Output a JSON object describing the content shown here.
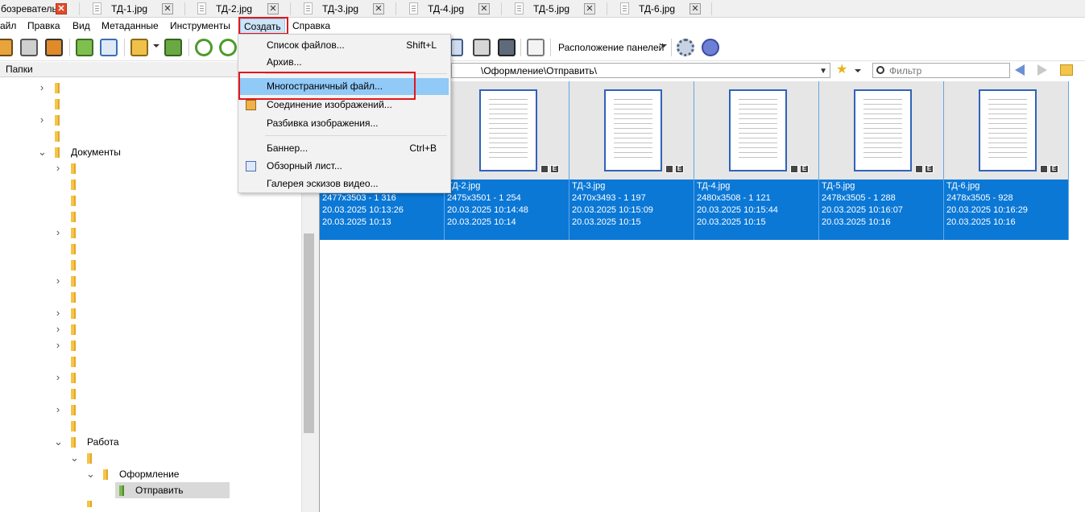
{
  "tabs": [
    {
      "label": "бозреватель",
      "close": "✕",
      "active": true
    },
    {
      "label": "ТД-1.jpg",
      "close": "✕"
    },
    {
      "label": "ТД-2.jpg",
      "close": "✕"
    },
    {
      "label": "ТД-3.jpg",
      "close": "✕"
    },
    {
      "label": "ТД-4.jpg",
      "close": "✕"
    },
    {
      "label": "ТД-5.jpg",
      "close": "✕"
    },
    {
      "label": "ТД-6.jpg",
      "close": "✕"
    }
  ],
  "menubar": {
    "items": [
      "айл",
      "Правка",
      "Вид",
      "Метаданные",
      "Инструменты",
      "Создать",
      "Справка"
    ],
    "open_item": "Создать"
  },
  "toolbar": {
    "layout_label": "Расположение панелей",
    "icons": [
      "slideshow-icon",
      "fullscreen-icon",
      "wallpaper-icon",
      "copy-to-icon",
      "properties-icon",
      "move-to-icon",
      "convert-icon",
      "rotate-left-icon",
      "rotate-right-icon",
      "print-icon",
      "scan-icon",
      "compare-icon",
      "settings-icon",
      "help-icon"
    ]
  },
  "panel": {
    "folders_title": "Папки"
  },
  "address": {
    "path": "\\Оформление\\Отправить\\"
  },
  "filter": {
    "placeholder": "Фильтр"
  },
  "dropdown": {
    "items": [
      {
        "label": "Список файлов...",
        "shortcut": "Shift+L",
        "icon": ""
      },
      {
        "label": "Архив...",
        "shortcut": "",
        "icon": ""
      },
      {
        "label": "Многостраничный файл...",
        "shortcut": "",
        "icon": "",
        "highlighted": true
      },
      {
        "label": "Соединение изображений...",
        "shortcut": "",
        "icon": "join-images-icon"
      },
      {
        "label": "Разбивка изображения...",
        "shortcut": "",
        "icon": ""
      },
      {
        "label": "Баннер...",
        "shortcut": "Ctrl+B",
        "icon": ""
      },
      {
        "label": "Обзорный лист...",
        "shortcut": "",
        "icon": "contact-sheet-icon"
      },
      {
        "label": "Галерея эскизов видео...",
        "shortcut": "",
        "icon": ""
      }
    ]
  },
  "tree": {
    "documents": "Документы",
    "work": "Работа",
    "design": "Оформление",
    "send": "Отправить"
  },
  "thumbnails": [
    {
      "name": "",
      "dims": "2477x3503 - 1 316",
      "modified": "20.03.2025 10:13:26",
      "created": "20.03.2025 10:13"
    },
    {
      "name": "ТД-2.jpg",
      "dims": "2475x3501 - 1 254",
      "modified": "20.03.2025 10:14:48",
      "created": "20.03.2025 10:14"
    },
    {
      "name": "ТД-3.jpg",
      "dims": "2470x3493 - 1 197",
      "modified": "20.03.2025 10:15:09",
      "created": "20.03.2025 10:15"
    },
    {
      "name": "ТД-4.jpg",
      "dims": "2480x3508 - 1 121",
      "modified": "20.03.2025 10:15:44",
      "created": "20.03.2025 10:15"
    },
    {
      "name": "ТД-5.jpg",
      "dims": "2478x3505 - 1 288",
      "modified": "20.03.2025 10:16:07",
      "created": "20.03.2025 10:16"
    },
    {
      "name": "ТД-6.jpg",
      "dims": "2478x3505 - 928",
      "modified": "20.03.2025 10:16:29",
      "created": "20.03.2025 10:16"
    }
  ],
  "badges": {
    "e": "E"
  },
  "colors": {
    "selection": "#0b78d6",
    "highlight": "#91c9f7",
    "annotation_red": "#e4161b",
    "folder": "#f3c54a"
  }
}
